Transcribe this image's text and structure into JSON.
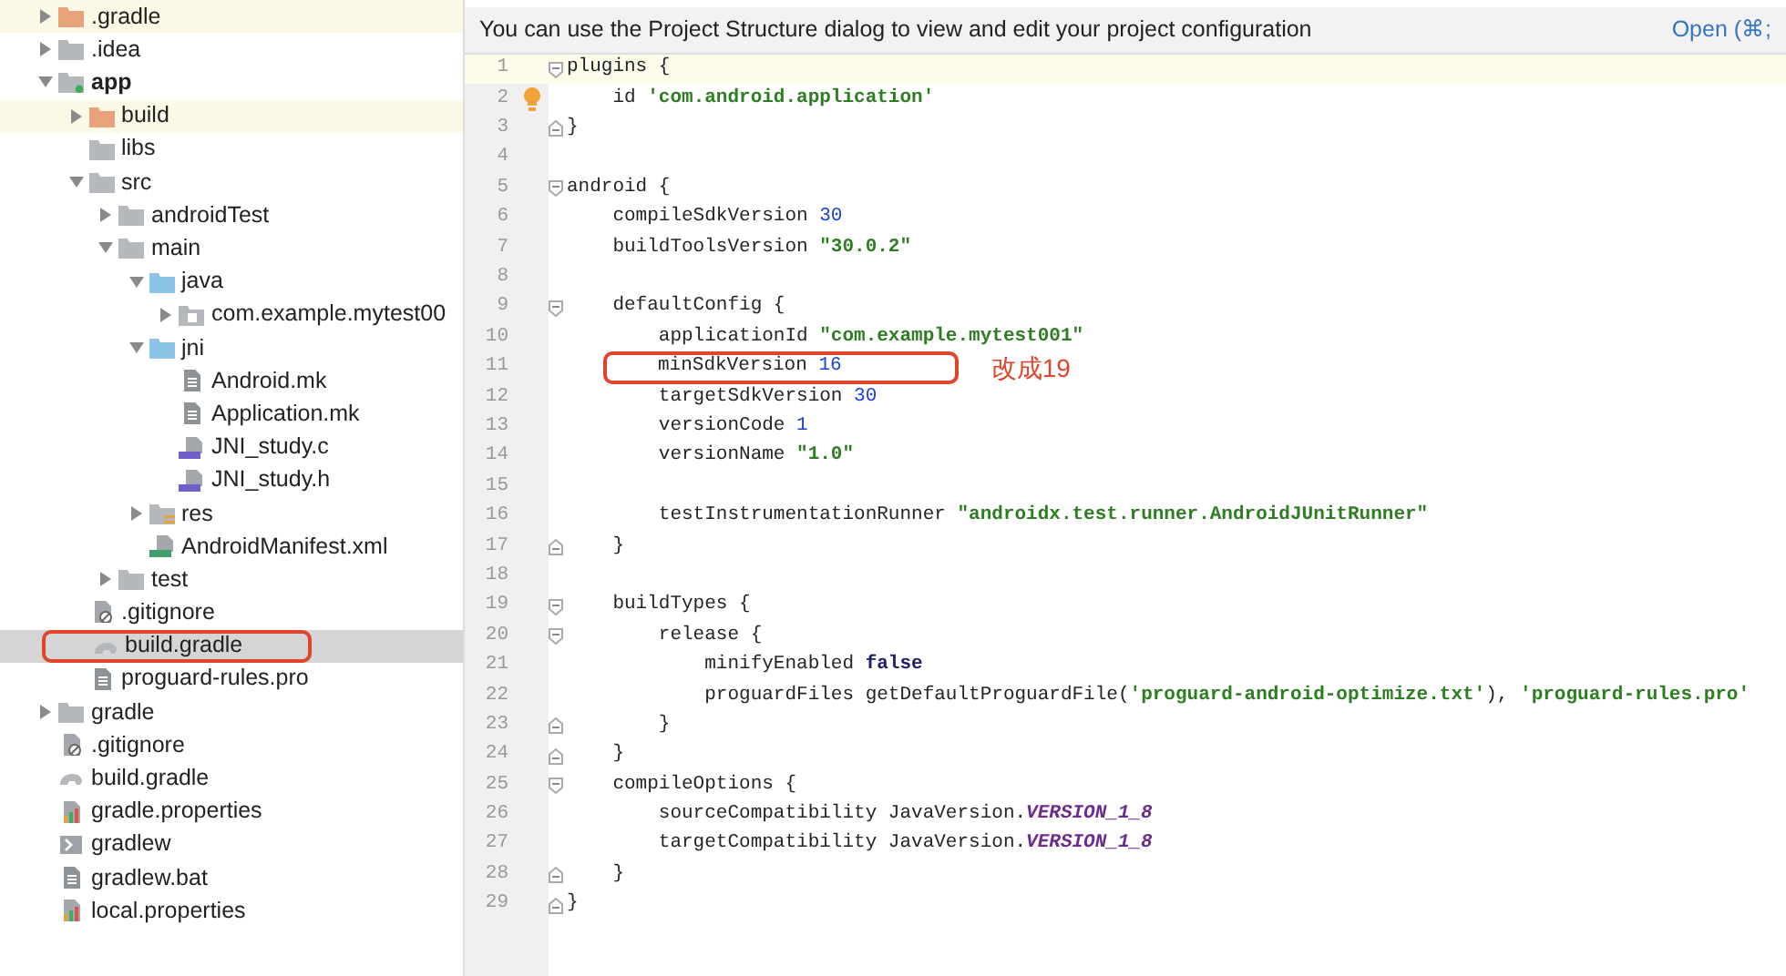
{
  "project_tree": [
    {
      "label": ".gradle",
      "kind": "folder",
      "expanded": false,
      "excluded": true,
      "selected": false,
      "circled": false,
      "bold": false
    },
    {
      "label": ".idea",
      "kind": "folder",
      "expanded": false,
      "excluded": false,
      "selected": false,
      "circled": false,
      "bold": false
    },
    {
      "label": "app",
      "kind": "module",
      "expanded": true,
      "excluded": false,
      "selected": false,
      "circled": false,
      "bold": true,
      "children": [
        {
          "label": "build",
          "kind": "folder",
          "expanded": false,
          "excluded": true,
          "selected": false,
          "circled": false,
          "bold": false
        },
        {
          "label": "libs",
          "kind": "folder",
          "excluded": false,
          "selected": false,
          "circled": false,
          "bold": false
        },
        {
          "label": "src",
          "kind": "folder",
          "expanded": true,
          "excluded": false,
          "selected": false,
          "circled": false,
          "bold": false,
          "children": [
            {
              "label": "androidTest",
              "kind": "folder",
              "expanded": false,
              "excluded": false,
              "selected": false,
              "circled": false,
              "bold": false
            },
            {
              "label": "main",
              "kind": "folder",
              "expanded": true,
              "excluded": false,
              "selected": false,
              "circled": false,
              "bold": false,
              "children": [
                {
                  "label": "java",
                  "kind": "source",
                  "expanded": true,
                  "excluded": false,
                  "selected": false,
                  "circled": false,
                  "bold": false,
                  "children": [
                    {
                      "label": "com.example.mytest00",
                      "kind": "package",
                      "expanded": false,
                      "excluded": false,
                      "selected": false,
                      "circled": false,
                      "bold": false
                    }
                  ]
                },
                {
                  "label": "jni",
                  "kind": "source",
                  "expanded": true,
                  "excluded": false,
                  "selected": false,
                  "circled": false,
                  "bold": false,
                  "children": [
                    {
                      "label": "Android.mk",
                      "kind": "text",
                      "excluded": false,
                      "selected": false,
                      "circled": false,
                      "bold": false
                    },
                    {
                      "label": "Application.mk",
                      "kind": "text",
                      "excluded": false,
                      "selected": false,
                      "circled": false,
                      "bold": false
                    },
                    {
                      "label": "JNI_study.c",
                      "kind": "cpp",
                      "excluded": false,
                      "selected": false,
                      "circled": false,
                      "bold": false
                    },
                    {
                      "label": "JNI_study.h",
                      "kind": "cpp",
                      "excluded": false,
                      "selected": false,
                      "circled": false,
                      "bold": false
                    }
                  ]
                },
                {
                  "label": "res",
                  "kind": "resources",
                  "expanded": false,
                  "excluded": false,
                  "selected": false,
                  "circled": false,
                  "bold": false
                },
                {
                  "label": "AndroidManifest.xml",
                  "kind": "manifest",
                  "excluded": false,
                  "selected": false,
                  "circled": false,
                  "bold": false
                }
              ]
            },
            {
              "label": "test",
              "kind": "folder",
              "expanded": false,
              "excluded": false,
              "selected": false,
              "circled": false,
              "bold": false
            }
          ]
        },
        {
          "label": ".gitignore",
          "kind": "ignore",
          "excluded": false,
          "selected": false,
          "circled": false,
          "bold": false
        },
        {
          "label": "build.gradle",
          "kind": "gradle",
          "excluded": false,
          "selected": true,
          "circled": true,
          "bold": false
        },
        {
          "label": "proguard-rules.pro",
          "kind": "text",
          "excluded": false,
          "selected": false,
          "circled": false,
          "bold": false
        }
      ]
    },
    {
      "label": "gradle",
      "kind": "folder",
      "expanded": false,
      "excluded": false,
      "selected": false,
      "circled": false,
      "bold": false
    },
    {
      "label": ".gitignore",
      "kind": "ignore",
      "excluded": false,
      "selected": false,
      "circled": false,
      "bold": false
    },
    {
      "label": "build.gradle",
      "kind": "gradle",
      "excluded": false,
      "selected": false,
      "circled": false,
      "bold": false
    },
    {
      "label": "gradle.properties",
      "kind": "properties",
      "excluded": false,
      "selected": false,
      "circled": false,
      "bold": false
    },
    {
      "label": "gradlew",
      "kind": "shell",
      "excluded": false,
      "selected": false,
      "circled": false,
      "bold": false
    },
    {
      "label": "gradlew.bat",
      "kind": "text",
      "excluded": false,
      "selected": false,
      "circled": false,
      "bold": false
    },
    {
      "label": "local.properties",
      "kind": "properties",
      "excluded": false,
      "selected": false,
      "circled": false,
      "bold": false
    }
  ],
  "banner": {
    "message": "You can use the Project Structure dialog to view and edit your project configuration",
    "link": "Open (⌘;"
  },
  "editor": {
    "lines": [
      {
        "number": "1",
        "fold_start": true,
        "current": true,
        "tokens": [
          {
            "kind": "plain",
            "text": "plugins {"
          }
        ]
      },
      {
        "number": "2",
        "lightbulb": true,
        "tokens": [
          {
            "kind": "plain",
            "text": "    id "
          },
          {
            "kind": "string",
            "text": "'com.android.application'"
          }
        ]
      },
      {
        "number": "3",
        "fold_end": true,
        "tokens": [
          {
            "kind": "plain",
            "text": "}"
          }
        ]
      },
      {
        "number": "4"
      },
      {
        "number": "5",
        "fold_start": true,
        "tokens": [
          {
            "kind": "plain",
            "text": "android {"
          }
        ]
      },
      {
        "number": "6",
        "tokens": [
          {
            "kind": "plain",
            "text": "    compileSdkVersion "
          },
          {
            "kind": "number",
            "text": "30"
          }
        ]
      },
      {
        "number": "7",
        "tokens": [
          {
            "kind": "plain",
            "text": "    buildToolsVersion "
          },
          {
            "kind": "string",
            "text": "\"30.0.2\""
          }
        ]
      },
      {
        "number": "8"
      },
      {
        "number": "9",
        "fold_start": true,
        "tokens": [
          {
            "kind": "plain",
            "text": "    defaultConfig {"
          }
        ]
      },
      {
        "number": "10",
        "tokens": [
          {
            "kind": "plain",
            "text": "        applicationId "
          },
          {
            "kind": "string",
            "text": "\"com.example.mytest001\""
          }
        ]
      },
      {
        "number": "11",
        "circled": true,
        "note": "改成19",
        "tokens": [
          {
            "kind": "plain",
            "text": "minSdkVersion "
          },
          {
            "kind": "number",
            "text": "16"
          }
        ]
      },
      {
        "number": "12",
        "tokens": [
          {
            "kind": "plain",
            "text": "        targetSdkVersion "
          },
          {
            "kind": "number",
            "text": "30"
          }
        ]
      },
      {
        "number": "13",
        "tokens": [
          {
            "kind": "plain",
            "text": "        versionCode "
          },
          {
            "kind": "number",
            "text": "1"
          }
        ]
      },
      {
        "number": "14",
        "tokens": [
          {
            "kind": "plain",
            "text": "        versionName "
          },
          {
            "kind": "string",
            "text": "\"1.0\""
          }
        ]
      },
      {
        "number": "15"
      },
      {
        "number": "16",
        "tokens": [
          {
            "kind": "plain",
            "text": "        testInstrumentationRunner "
          },
          {
            "kind": "string",
            "text": "\"androidx.test.runner.AndroidJUnitRunner\""
          }
        ]
      },
      {
        "number": "17",
        "fold_end": true,
        "tokens": [
          {
            "kind": "plain",
            "text": "    }"
          }
        ]
      },
      {
        "number": "18"
      },
      {
        "number": "19",
        "fold_start": true,
        "tokens": [
          {
            "kind": "plain",
            "text": "    buildTypes {"
          }
        ]
      },
      {
        "number": "20",
        "fold_start": true,
        "tokens": [
          {
            "kind": "plain",
            "text": "        release {"
          }
        ]
      },
      {
        "number": "21",
        "tokens": [
          {
            "kind": "plain",
            "text": "            minifyEnabled "
          },
          {
            "kind": "keyword",
            "text": "false"
          }
        ]
      },
      {
        "number": "22",
        "tokens": [
          {
            "kind": "plain",
            "text": "            proguardFiles getDefaultProguardFile("
          },
          {
            "kind": "string",
            "text": "'proguard-android-optimize.txt'"
          },
          {
            "kind": "plain",
            "text": "), "
          },
          {
            "kind": "string",
            "text": "'proguard-rules.pro'"
          }
        ]
      },
      {
        "number": "23",
        "fold_end": true,
        "tokens": [
          {
            "kind": "plain",
            "text": "        }"
          }
        ]
      },
      {
        "number": "24",
        "fold_end": true,
        "tokens": [
          {
            "kind": "plain",
            "text": "    }"
          }
        ]
      },
      {
        "number": "25",
        "fold_start": true,
        "tokens": [
          {
            "kind": "plain",
            "text": "    compileOptions {"
          }
        ]
      },
      {
        "number": "26",
        "tokens": [
          {
            "kind": "plain",
            "text": "        sourceCompatibility JavaVersion."
          },
          {
            "kind": "constant",
            "text": "VERSION_1_8"
          }
        ]
      },
      {
        "number": "27",
        "tokens": [
          {
            "kind": "plain",
            "text": "        targetCompatibility JavaVersion."
          },
          {
            "kind": "constant",
            "text": "VERSION_1_8"
          }
        ]
      },
      {
        "number": "28",
        "fold_end": true,
        "tokens": [
          {
            "kind": "plain",
            "text": "    }"
          }
        ]
      },
      {
        "number": "29",
        "fold_end": true,
        "tokens": [
          {
            "kind": "plain",
            "text": "}"
          }
        ]
      }
    ]
  }
}
